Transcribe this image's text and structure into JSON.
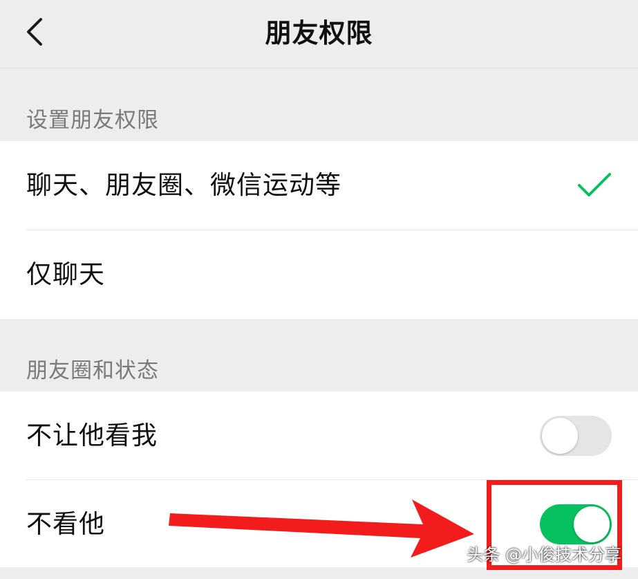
{
  "navbar": {
    "title": "朋友权限",
    "back_icon": "chevron-left-icon"
  },
  "permission_section": {
    "header": "设置朋友权限",
    "options": [
      {
        "label": "聊天、朋友圈、微信运动等",
        "selected": true
      },
      {
        "label": "仅聊天",
        "selected": false
      }
    ]
  },
  "moments_section": {
    "header": "朋友圈和状态",
    "toggles": [
      {
        "label": "不让他看我",
        "enabled": false
      },
      {
        "label": "不看他",
        "enabled": true
      }
    ]
  },
  "annotation": {
    "watermark": "头条 @小俊技术分享",
    "highlight_color": "#f21c1c"
  },
  "colors": {
    "accent_green": "#07c160",
    "background": "#ededed",
    "switch_off": "#e5e5e5"
  }
}
